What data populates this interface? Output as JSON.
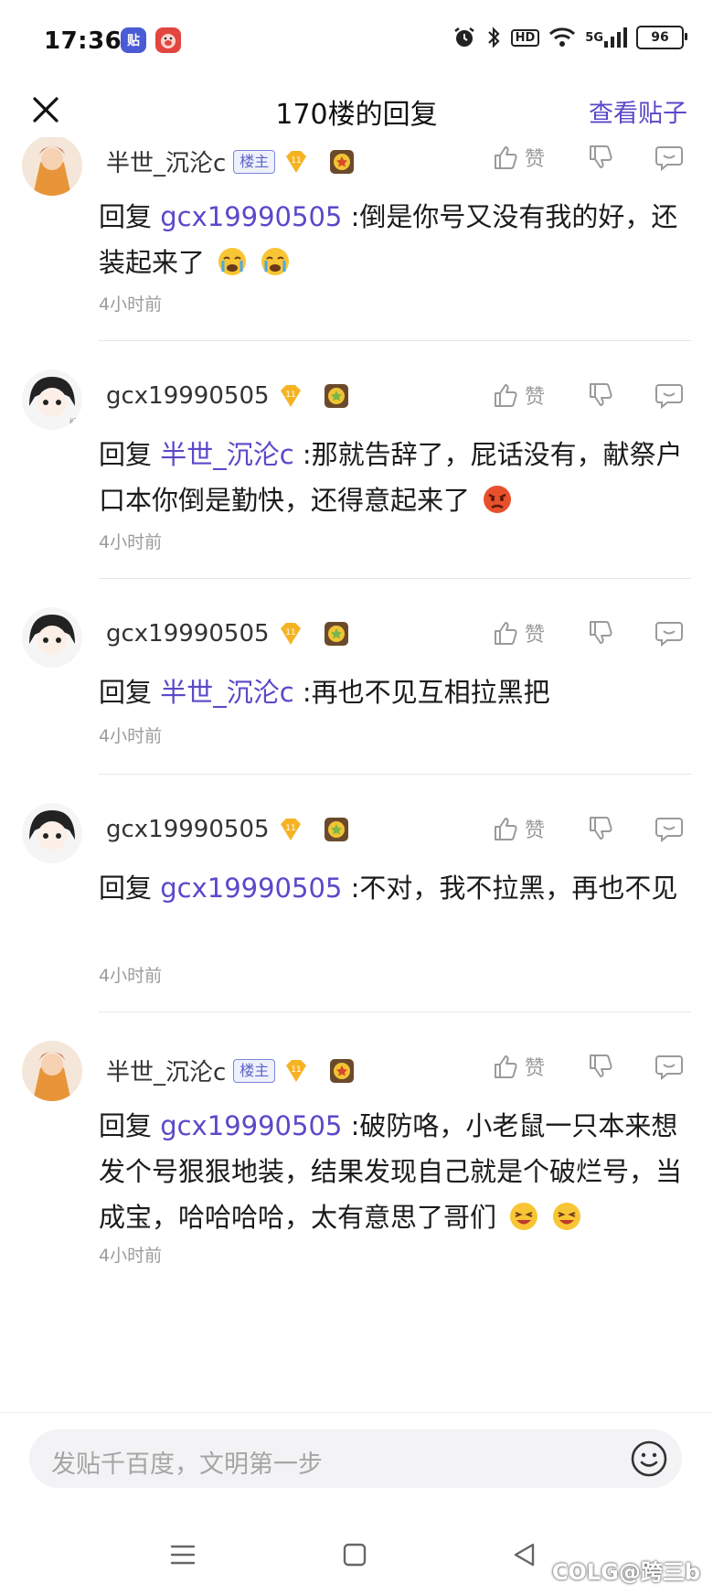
{
  "status_bar": {
    "time": "17:36",
    "app_icons": [
      "贴",
      "🐷"
    ],
    "icons": [
      "alarm-icon",
      "bluetooth-icon",
      "hd-icon",
      "wifi-icon",
      "5g-signal-icon"
    ],
    "hd_label": "HD",
    "network_label": "5G",
    "battery": "96"
  },
  "header": {
    "title": "170楼的回复",
    "view_post": "查看贴子"
  },
  "actions": {
    "like_label": "赞"
  },
  "replies": [
    {
      "user": "半世_沉沦c",
      "owner_badge": "楼主",
      "level": "11",
      "reply_prefix": "回复",
      "mention": "gcx19990505",
      "text": ":倒是你号又没有我的好，还装起来了",
      "emojis": [
        "cry-emoji",
        "cry-emoji"
      ],
      "time": "4小时前"
    },
    {
      "user": "gcx19990505",
      "level": "11",
      "reply_prefix": "回复",
      "mention": "半世_沉沦c",
      "text": ":那就告辞了，屁话没有，献祭户口本你倒是勤快，还得意起来了",
      "emojis": [
        "angry-emoji"
      ],
      "time": "4小时前"
    },
    {
      "user": "gcx19990505",
      "level": "11",
      "reply_prefix": "回复",
      "mention": "半世_沉沦c",
      "text": ":再也不见互相拉黑把",
      "emojis": [],
      "time": "4小时前"
    },
    {
      "user": "gcx19990505",
      "level": "11",
      "reply_prefix": "回复",
      "mention": "gcx19990505",
      "text": ":不对，我不拉黑，再也不见",
      "emojis": [],
      "time": "4小时前"
    },
    {
      "user": "半世_沉沦c",
      "owner_badge": "楼主",
      "level": "11",
      "reply_prefix": "回复",
      "mention": "gcx19990505",
      "text": ":破防咯，小老鼠一只本来想发个号狠狠地装，结果发现自己就是个破烂号，当成宝，哈哈哈哈，太有意思了哥们",
      "emojis": [
        "laugh-emoji",
        "laugh-emoji"
      ],
      "time": "4小时前"
    }
  ],
  "composer": {
    "placeholder": "发贴千百度，文明第一步"
  },
  "watermark": "COLG@跨三b",
  "colors": {
    "accent": "#5a49c9",
    "owner_badge": "#5b63c7",
    "muted": "#9b9b9b"
  }
}
